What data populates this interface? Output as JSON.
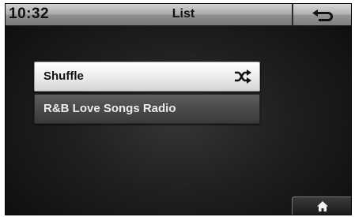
{
  "status_bar": {
    "time": "10:32",
    "title": "List",
    "back_icon": "back-arrow-icon"
  },
  "list": {
    "items": [
      {
        "label": "Shuffle",
        "icon": "shuffle-icon",
        "selected": true
      },
      {
        "label": "R&B Love Songs Radio",
        "selected": false
      }
    ]
  },
  "footer": {
    "home_icon": "home-icon"
  },
  "colors": {
    "selected_item_bg": "#ededed",
    "unselected_item_bg": "#4a4a4a",
    "status_bar_bg": "#a9a9a9"
  }
}
